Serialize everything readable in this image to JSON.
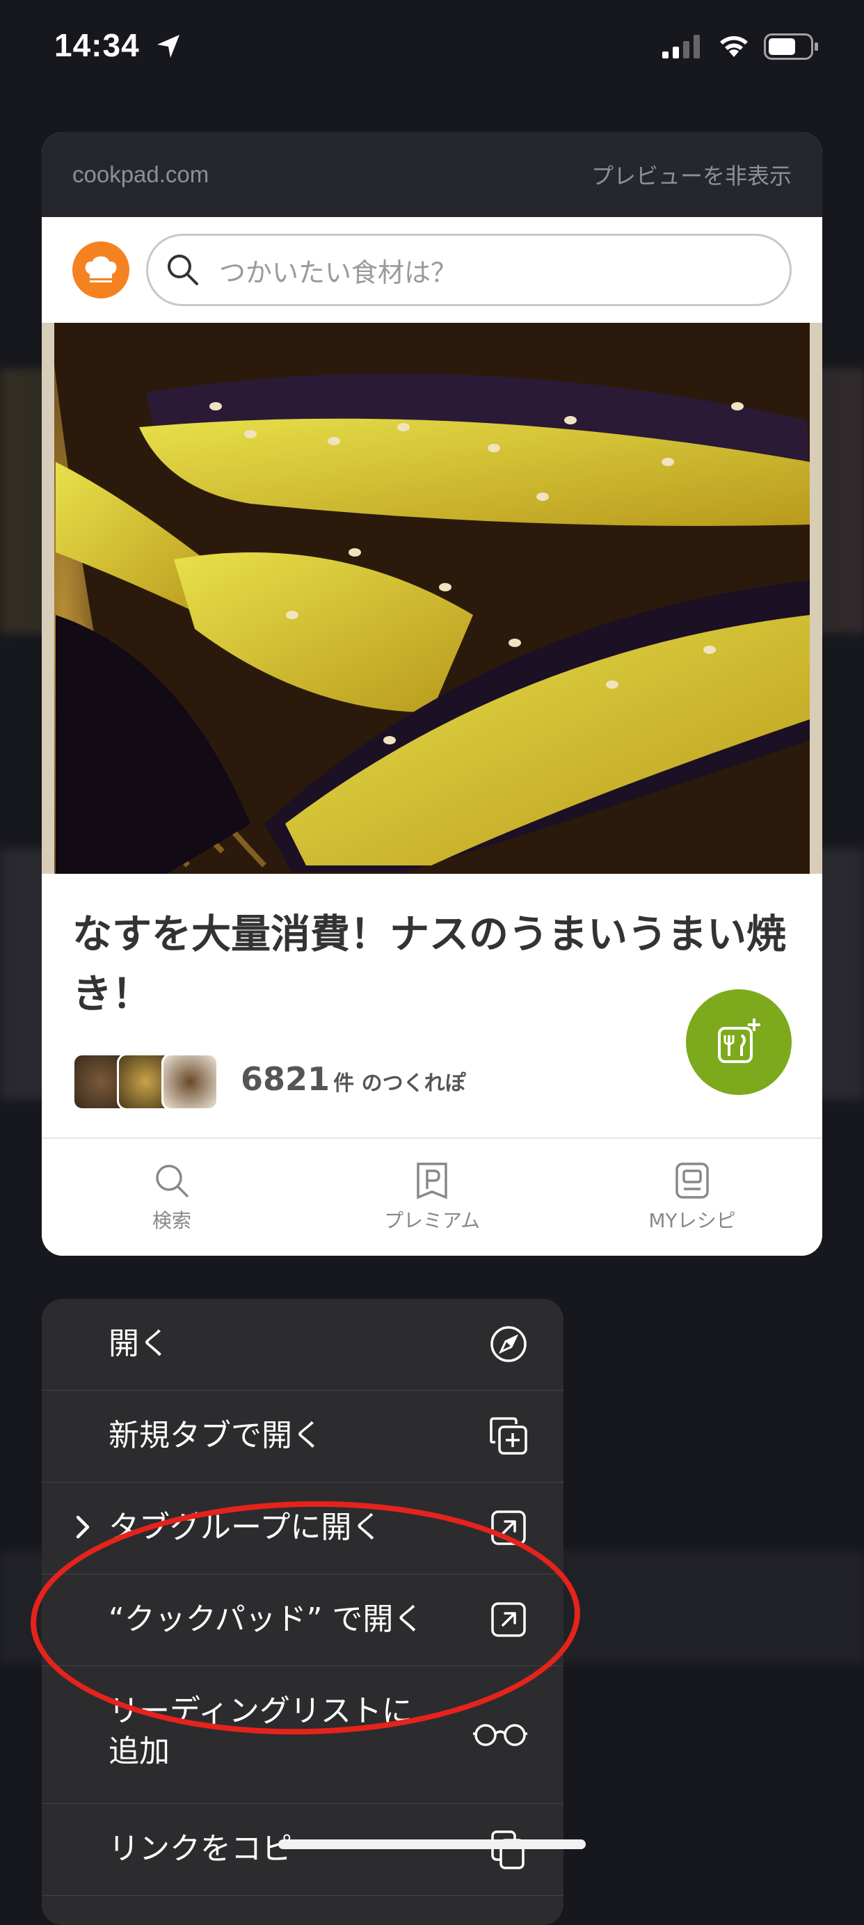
{
  "status_bar": {
    "time": "14:34"
  },
  "preview": {
    "domain": "cookpad.com",
    "hide_label": "プレビューを非表示",
    "search_placeholder": "つかいたい食材は？",
    "recipe_title": "なすを大量消費！ナスのうまいうまい焼き！",
    "tsukurepo_count": "6821",
    "tsukurepo_unit": "件 のつくれぽ",
    "tabs": [
      {
        "label": "検索",
        "icon": "search-icon"
      },
      {
        "label": "プレミアム",
        "icon": "premium-icon"
      },
      {
        "label": "MYレシピ",
        "icon": "my-recipe-icon"
      }
    ]
  },
  "menu": {
    "items": [
      {
        "label": "開く",
        "icon": "compass-icon"
      },
      {
        "label": "新規タブで開く",
        "icon": "new-tab-icon"
      },
      {
        "label": "タブグループに開く",
        "icon": "open-external-icon"
      },
      {
        "label": "“クックパッド” で開く",
        "icon": "open-external-icon"
      },
      {
        "label": "リーディングリストに追加",
        "icon": "glasses-icon"
      },
      {
        "label": "リンクをコピー",
        "icon": "copy-icon"
      }
    ]
  },
  "colors": {
    "accent_orange": "#f58221",
    "fab_green": "#7caa1c",
    "annotation_red": "#e5231b"
  }
}
